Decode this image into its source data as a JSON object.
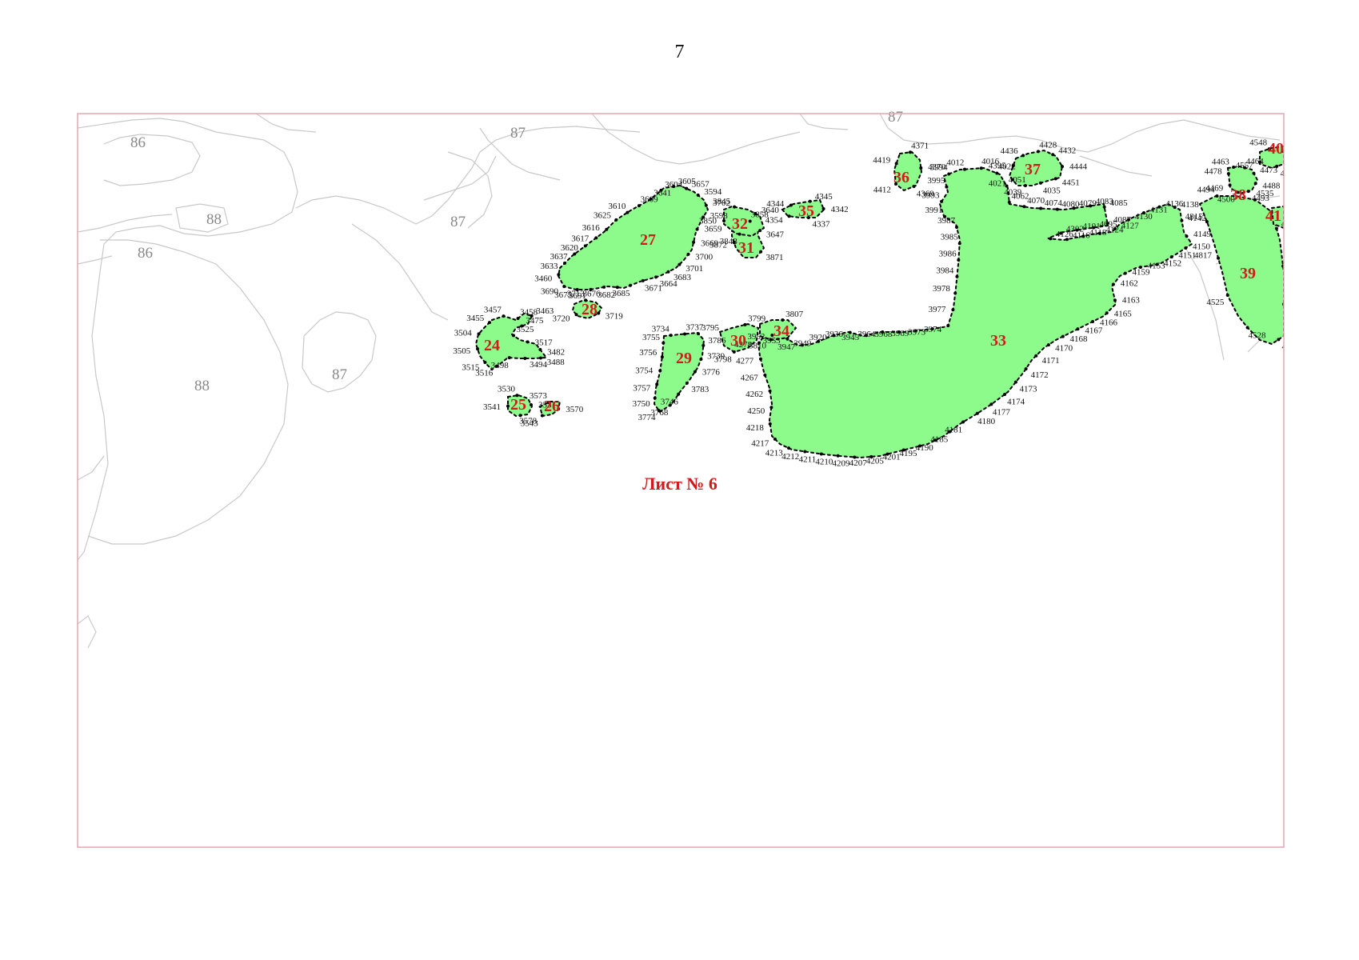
{
  "page_number": "7",
  "sheet_label": "Лист № 6",
  "colors": {
    "parcel_fill": "#8cfb8c",
    "frame": "#e3a6b0",
    "background_lines": "#c8c8c8",
    "label_red": "#d21a1a"
  },
  "background_labels": [
    "86",
    "87",
    "88",
    "86",
    "87",
    "88",
    "87",
    "87"
  ],
  "parcels": [
    {
      "id": "24",
      "points": [
        "3455",
        "3457",
        "3458",
        "3463",
        "3475",
        "3525",
        "3517",
        "3482",
        "3488",
        "3494",
        "3498",
        "3516",
        "3515",
        "3505",
        "3504"
      ]
    },
    {
      "id": "25",
      "points": [
        "3530",
        "3531",
        "3543",
        "3541"
      ]
    },
    {
      "id": "26",
      "points": [
        "3573",
        "3570",
        "3578"
      ]
    },
    {
      "id": "27",
      "points": [
        "3633",
        "3637",
        "3620",
        "3617",
        "3616",
        "3625",
        "3610",
        "3609",
        "3641",
        "3604",
        "3605",
        "3657",
        "3594",
        "3702",
        "3598",
        "3659",
        "3669",
        "3700",
        "3701",
        "3683",
        "3664",
        "3671",
        "3685",
        "3682",
        "3676",
        "3691",
        "3675",
        "3690",
        "3460"
      ]
    },
    {
      "id": "28",
      "points": [
        "3713",
        "3719",
        "3720"
      ]
    },
    {
      "id": "29",
      "points": [
        "3734",
        "3737",
        "3795",
        "3786",
        "3739",
        "3776",
        "3783",
        "3746",
        "3768",
        "3774",
        "3750",
        "3757",
        "3754",
        "3756",
        "3755"
      ]
    },
    {
      "id": "30",
      "points": [
        "3799",
        "3798"
      ]
    },
    {
      "id": "31",
      "points": [
        "3858",
        "3871",
        "3872"
      ]
    },
    {
      "id": "32",
      "points": [
        "3845",
        "3640",
        "3647",
        "3848",
        "3850"
      ]
    },
    {
      "id": "33",
      "points": [
        "3952",
        "3953",
        "3947",
        "3949",
        "3920",
        "3936",
        "3945",
        "3964",
        "3968",
        "3969",
        "3973",
        "3974",
        "3977",
        "3978",
        "3984",
        "3986",
        "3985",
        "3987",
        "3991",
        "3993",
        "3995",
        "3994",
        "4012",
        "4016",
        "4022",
        "4051",
        "4062",
        "4070",
        "4074",
        "4080",
        "4079",
        "4083",
        "4085",
        "4087",
        "4095",
        "4101",
        "4302",
        "4126",
        "4116",
        "4118",
        "4124",
        "4127",
        "4130",
        "4131",
        "4136",
        "4138",
        "4142",
        "4149",
        "4150",
        "4151",
        "4152",
        "4153",
        "4159",
        "4162",
        "4163",
        "4165",
        "4166",
        "4167",
        "4168",
        "4170",
        "4171",
        "4172",
        "4173",
        "4174",
        "4177",
        "4180",
        "4181",
        "4185",
        "4190",
        "4195",
        "4201",
        "4205",
        "4207",
        "4209",
        "4210",
        "4211",
        "4212",
        "4213",
        "4217",
        "4218",
        "4250",
        "4262",
        "4267",
        "4277",
        "4278"
      ]
    },
    {
      "id": "34",
      "points": [
        "3807",
        "3810"
      ]
    },
    {
      "id": "35",
      "points": [
        "4344",
        "4345",
        "4342",
        "4337",
        "4354"
      ]
    },
    {
      "id": "36",
      "points": [
        "4371",
        "4370",
        "4369",
        "4412",
        "4419"
      ]
    },
    {
      "id": "37",
      "points": [
        "4436",
        "4428",
        "4432",
        "4444",
        "4451",
        "4035",
        "4039",
        "4021",
        "4395"
      ]
    },
    {
      "id": "38",
      "points": [
        "4463",
        "4464",
        "4473",
        "4488",
        "4493",
        "4500",
        "4469",
        "4478"
      ]
    },
    {
      "id": "39",
      "points": [
        "4494",
        "4535",
        "4532",
        "4530",
        "4529",
        "4527",
        "4528",
        "4525",
        "4817",
        "4815"
      ]
    },
    {
      "id": "40",
      "points": [
        "4548",
        "4541",
        "4540",
        "4557"
      ]
    },
    {
      "id": "41",
      "points": []
    }
  ]
}
